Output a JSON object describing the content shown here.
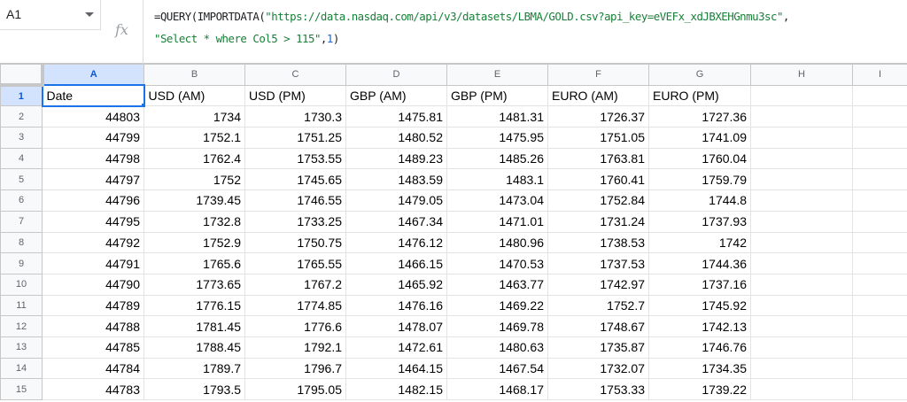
{
  "name_box": {
    "value": "A1"
  },
  "formula_bar": {
    "fx_symbol": "fx",
    "line1": [
      {
        "t": "=QUERY(IMPORTDATA(",
        "k": "func"
      },
      {
        "t": "\"https://data.nasdaq.com/api/v3/datasets/LBMA/GOLD.csv?api_key=eVEFx_xdJBXEHGnmu3sc\"",
        "k": "str"
      },
      {
        "t": ",",
        "k": "func"
      }
    ],
    "line2": [
      {
        "t": "\"Select * where Col5 > 115\"",
        "k": "str"
      },
      {
        "t": ",",
        "k": "func"
      },
      {
        "t": "1",
        "k": "num"
      },
      {
        "t": ")",
        "k": "func"
      }
    ]
  },
  "sheet": {
    "columns": [
      "A",
      "B",
      "C",
      "D",
      "E",
      "F",
      "G",
      "H",
      "I"
    ],
    "selected_cell": "A1",
    "header_row": [
      "Date",
      "USD (AM)",
      "USD (PM)",
      "GBP (AM)",
      "GBP (PM)",
      "EURO (AM)",
      "EURO (PM)",
      "",
      ""
    ],
    "rows": [
      [
        "44803",
        "1734",
        "1730.3",
        "1475.81",
        "1481.31",
        "1726.37",
        "1727.36"
      ],
      [
        "44799",
        "1752.1",
        "1751.25",
        "1480.52",
        "1475.95",
        "1751.05",
        "1741.09"
      ],
      [
        "44798",
        "1762.4",
        "1753.55",
        "1489.23",
        "1485.26",
        "1763.81",
        "1760.04"
      ],
      [
        "44797",
        "1752",
        "1745.65",
        "1483.59",
        "1483.1",
        "1760.41",
        "1759.79"
      ],
      [
        "44796",
        "1739.45",
        "1746.55",
        "1479.05",
        "1473.04",
        "1752.84",
        "1744.8"
      ],
      [
        "44795",
        "1732.8",
        "1733.25",
        "1467.34",
        "1471.01",
        "1731.24",
        "1737.93"
      ],
      [
        "44792",
        "1752.9",
        "1750.75",
        "1476.12",
        "1480.96",
        "1738.53",
        "1742"
      ],
      [
        "44791",
        "1765.6",
        "1765.55",
        "1466.15",
        "1470.53",
        "1737.53",
        "1744.36"
      ],
      [
        "44790",
        "1773.65",
        "1767.2",
        "1465.92",
        "1463.77",
        "1742.97",
        "1737.16"
      ],
      [
        "44789",
        "1776.15",
        "1774.85",
        "1476.16",
        "1469.22",
        "1752.7",
        "1745.92"
      ],
      [
        "44788",
        "1781.45",
        "1776.6",
        "1478.07",
        "1469.78",
        "1748.67",
        "1742.13"
      ],
      [
        "44785",
        "1788.45",
        "1792.1",
        "1472.61",
        "1480.63",
        "1735.87",
        "1746.76"
      ],
      [
        "44784",
        "1789.7",
        "1796.7",
        "1464.15",
        "1467.54",
        "1732.07",
        "1734.35"
      ],
      [
        "44783",
        "1793.5",
        "1795.05",
        "1482.15",
        "1468.17",
        "1753.33",
        "1739.22"
      ]
    ]
  }
}
